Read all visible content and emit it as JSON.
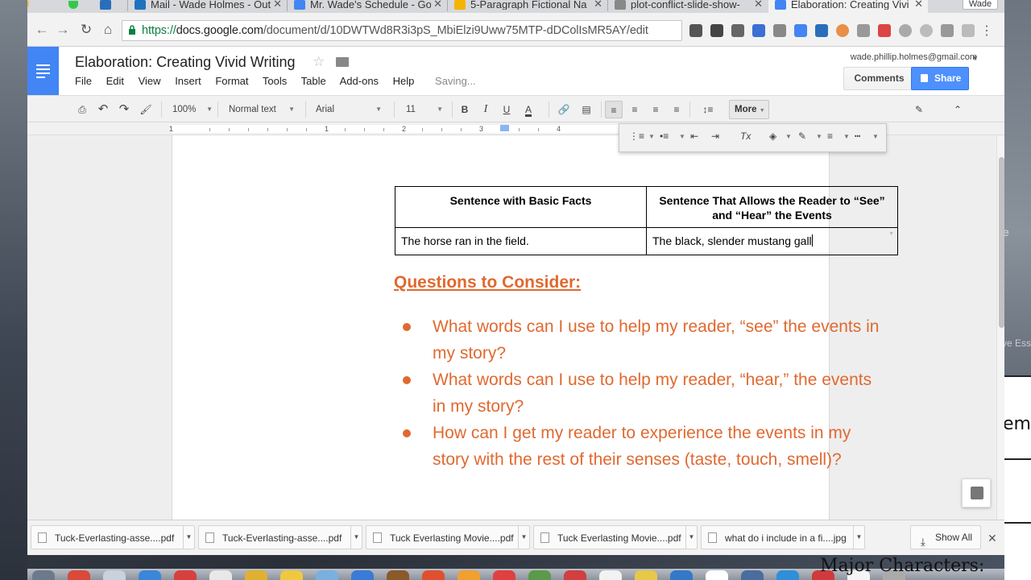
{
  "tabs": [
    {
      "title": "Mail - Wade Holmes - Out",
      "favicon_color": "#1e73be"
    },
    {
      "title": "Mr. Wade's Schedule - Go",
      "favicon_color": "#4285f4"
    },
    {
      "title": "5-Paragraph Fictional Na",
      "favicon_color": "#f4b400"
    },
    {
      "title": "plot-conflict-slide-show-",
      "favicon_color": "#888888"
    },
    {
      "title": "Elaboration: Creating Vivi",
      "favicon_color": "#4285f4"
    }
  ],
  "profile_name": "Wade",
  "omnibox": {
    "scheme": "https://",
    "host": "docs.google.com",
    "path": "/document/d/10DWTWd8R3i3pS_MbiElzi9Uww75MTP-dDColIsMR5AY/edit"
  },
  "doc": {
    "title": "Elaboration: Creating Vivid Writing",
    "menu": [
      "File",
      "Edit",
      "View",
      "Insert",
      "Format",
      "Tools",
      "Table",
      "Add-ons",
      "Help"
    ],
    "status": "Saving...",
    "account": "wade.phillip.holmes@gmail.com",
    "comments_label": "Comments",
    "share_label": "Share"
  },
  "toolbar": {
    "zoom": "100%",
    "style": "Normal text",
    "font": "Arial",
    "size": "11",
    "bold": "B",
    "italic": "I",
    "underline": "U",
    "text_color": "A",
    "more_label": "More"
  },
  "ruler_numbers": [
    "1",
    "1",
    "2",
    "3",
    "4"
  ],
  "table": {
    "header": [
      "Sentence with Basic Facts",
      "Sentence That Allows the Reader to “See” and “Hear” the Events"
    ],
    "row": [
      "The horse ran in the field.",
      "The black, slender mustang gall"
    ]
  },
  "questions_heading": "Questions to Consider:",
  "questions": [
    "What words can I use to help my reader, “see” the events in my story?",
    "What words can I use to help my reader, “hear,” the events in my story?",
    "How can I get my reader to experience the events in my story with the rest of their senses (taste, touch, smell)?"
  ],
  "downloads": [
    "Tuck-Everlasting-asse....pdf",
    "Tuck-Everlasting-asse....pdf",
    "Tuck Everlasting Movie....pdf",
    "Tuck Everlasting Movie....pdf",
    "what do i include in a fi....jpg"
  ],
  "show_all_label": "Show All",
  "background_peek": {
    "gray_text": "ve Ess",
    "doc_text": "em",
    "bottom_text": "Major Characters:"
  },
  "colors": {
    "accent": "#e06930",
    "share": "#4d90fe",
    "docs_blue": "#4285f4"
  }
}
